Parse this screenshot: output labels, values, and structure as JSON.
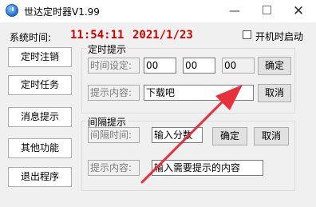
{
  "window": {
    "title": "世达定时器V1.99",
    "minimize": "—",
    "close": "✕"
  },
  "system": {
    "time_label": "系统时间:",
    "time_value": "11:54:11",
    "date_value": "2021/1/23",
    "autostart_label": "开机时启动",
    "autostart_checked": false
  },
  "sidebar": {
    "buttons": [
      "定时注销",
      "定时任务",
      "消息提示",
      "其他功能",
      "退出程序"
    ]
  },
  "timer_group": {
    "title": "定时提示",
    "time_label": "时间设定:",
    "hour": "00",
    "minute": "00",
    "second": "00",
    "confirm": "确定",
    "content_label": "提示内容:",
    "content_value": "下载吧",
    "cancel": "取消"
  },
  "interval_group": {
    "title": "间隔提示",
    "interval_label": "间隔时间:",
    "interval_placeholder": "输入分数",
    "confirm": "确定",
    "cancel": "取消",
    "content_label": "提示内容:",
    "content_placeholder": "输入需要提示的内容"
  },
  "colors": {
    "accent_red": "#d00000",
    "arrow": "#e8303c"
  },
  "icons": [
    "app-clock-icon",
    "annotation-arrow"
  ]
}
